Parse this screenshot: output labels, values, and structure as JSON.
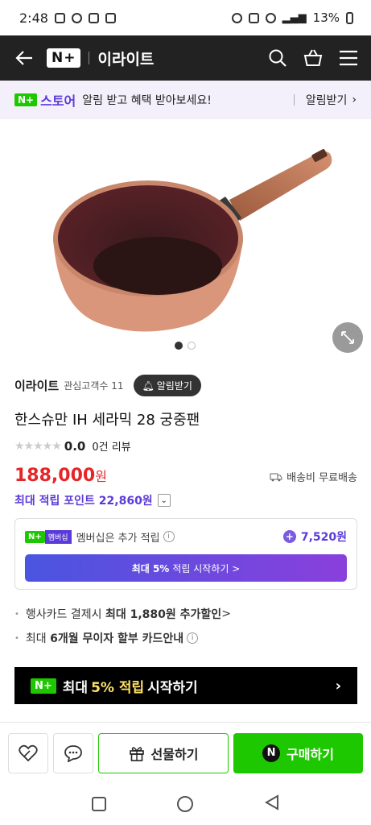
{
  "status_bar": {
    "time": "2:48",
    "battery": "13%"
  },
  "header": {
    "brand": "N+",
    "store_name": "이라이트"
  },
  "notice": {
    "badge": "N+",
    "store_label": "스토어",
    "message": "알림 받고 혜택 받아보세요!",
    "action": "알림받기"
  },
  "seller": {
    "name": "이라이트",
    "followers": "관심고객수 11",
    "alarm_button": "알림받기"
  },
  "product": {
    "title": "한스슈만 IH 세라믹 28 궁중팬",
    "rating": "0.0",
    "reviews": "0건 리뷰",
    "price": "188,000",
    "price_unit": "원",
    "shipping": "배송비 무료배송",
    "points": "최대 적립 포인트 22,860원"
  },
  "membership": {
    "badge": "N+",
    "badge2": "멤버십",
    "text": "멤버십은 추가 적립",
    "points": "7,520원",
    "cta_bold": "최대 5%",
    "cta_text": "적립 시작하기 >"
  },
  "benefits": [
    {
      "pre": "행사카드 결제시 ",
      "bold": "최대 1,880원 추가할인",
      "post": " >"
    },
    {
      "pre": "최대 ",
      "bold": "6개월 무이자 할부 카드안내",
      "post": ""
    }
  ],
  "promo": {
    "badge": "N+",
    "pre": "최대",
    "highlight": "5% 적립",
    "post": "시작하기"
  },
  "bottom": {
    "gift": "선물하기",
    "buy": "구매하기"
  },
  "image": {
    "slides_total": 2,
    "slide_active": 1
  },
  "colors": {
    "naver_green": "#1ec800",
    "purple": "#5b3bd8",
    "price_red": "#e52528"
  }
}
